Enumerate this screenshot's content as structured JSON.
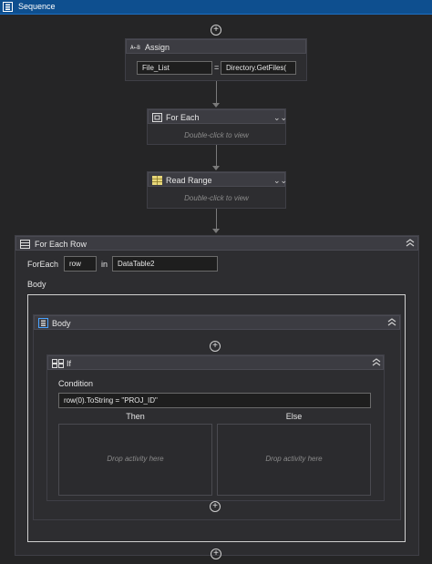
{
  "title": "Sequence",
  "assign": {
    "label": "Assign",
    "to_value": "File_List",
    "equals": "=",
    "expr_value": "Directory.GetFiles("
  },
  "foreach": {
    "label": "For Each",
    "hint": "Double-click to view"
  },
  "readrange": {
    "label": "Read Range",
    "hint": "Double-click to view"
  },
  "foreachrow": {
    "label": "For Each Row",
    "foreach_label": "ForEach",
    "item_value": "row",
    "in_label": "in",
    "datatable_value": "DataTable2",
    "body_label": "Body"
  },
  "body_seq": {
    "label": "Body"
  },
  "if": {
    "label": "If",
    "condition_label": "Condition",
    "condition_value": "row(0).ToString =  \"PROJ_ID\"",
    "then_label": "Then",
    "else_label": "Else",
    "drop_then": "Drop activity here",
    "drop_else": "Drop activity here"
  },
  "icons": {
    "plus": "+",
    "collapse": "⌃⌃",
    "expand": "⌄⌄"
  },
  "colors": {
    "titlebar": "#0e4f8f",
    "background": "#252526",
    "activity": "#2d2d30"
  }
}
